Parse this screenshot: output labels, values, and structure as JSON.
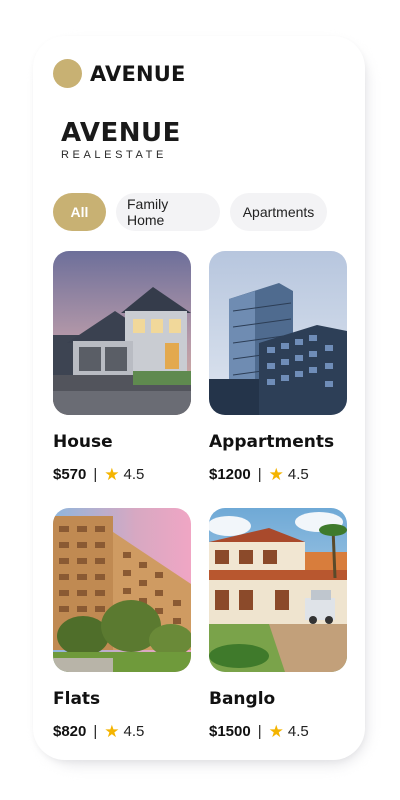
{
  "header": {
    "brand": "AVENUE",
    "accent": "#c8b173"
  },
  "logo": {
    "main": "AVENUE",
    "sub": "REALESTATE"
  },
  "filters": [
    {
      "label": "All",
      "active": true
    },
    {
      "label": "Family Home",
      "active": false
    },
    {
      "label": "Apartments",
      "active": false
    }
  ],
  "listings": [
    {
      "title": "House",
      "price": "$570",
      "separator": "|",
      "rating": "4.5",
      "image": "house-photo"
    },
    {
      "title": "Appartments",
      "price": "$1200",
      "separator": "|",
      "rating": "4.5",
      "image": "tower-photo"
    },
    {
      "title": "Flats",
      "price": "$820",
      "separator": "|",
      "rating": "4.5",
      "image": "flats-photo"
    },
    {
      "title": "Banglo",
      "price": "$1500",
      "separator": "|",
      "rating": "4.5",
      "image": "bungalow-photo"
    }
  ],
  "icons": {
    "star": "star-icon",
    "logo": "logo-dot-icon"
  },
  "colors": {
    "star": "#f4b400",
    "chip_bg": "#f3f3f5"
  }
}
